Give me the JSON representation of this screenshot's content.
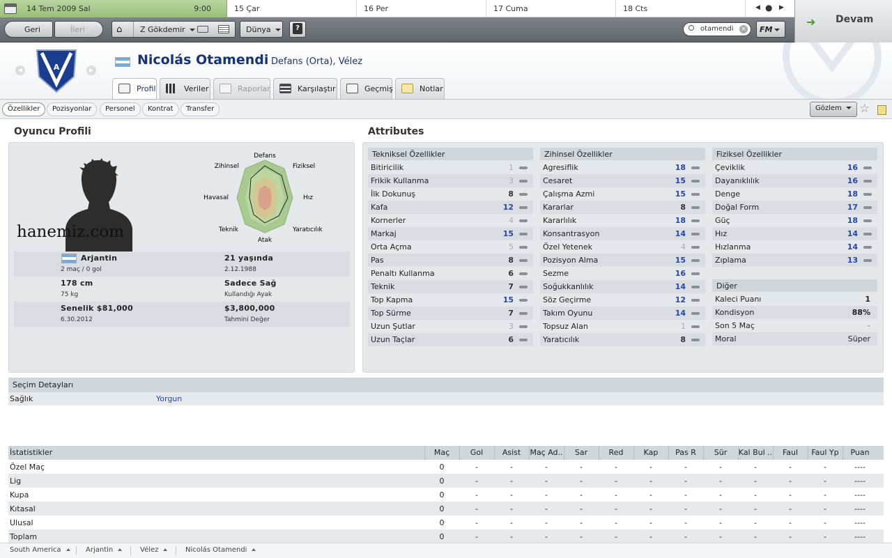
{
  "date_bar": {
    "today": {
      "date": "14 Tem 2009  Sal",
      "time": "9:00"
    },
    "days": [
      "15  Çar",
      "16  Per",
      "17  Cuma",
      "18  Cts"
    ]
  },
  "toolbar": {
    "back": "Geri",
    "forward": "İleri",
    "manager": "Z Gökdemir",
    "world": "Dünya",
    "help": "?",
    "search_value": "otamendi",
    "fm_menu": "FM",
    "continue": "Devam"
  },
  "player": {
    "name": "Nicolás Otamendi",
    "position": "Defans (Orta), Vélez"
  },
  "tabs": [
    "Profil",
    "Veriler",
    "Raporlar",
    "Karşılaştır",
    "Geçmiş",
    "Notlar"
  ],
  "subtabs": [
    "Özellikler",
    "Pozisyonlar",
    "Personel",
    "Kontrat",
    "Transfer"
  ],
  "scout_button": "Gözlem",
  "profile": {
    "title": "Oyuncu Profili",
    "watermark": "hanemiz.com",
    "radar_labels": [
      "Defans",
      "Fiziksel",
      "Hız",
      "Yaratıcılık",
      "Atak",
      "Teknik",
      "Havasal",
      "Zihinsel"
    ],
    "nation": "Arjantin",
    "caps": "2 maç / 0 gol",
    "age": "21 yaşında",
    "dob": "2.12.1988",
    "height": "178 cm",
    "weight": "75 kg",
    "foot": "Sadece Sağ",
    "foot_label": "Kullandığı Ayak",
    "wage": "Senelik $81,000",
    "contract_end": "6.30.2012",
    "value": "$3,800,000",
    "value_label": "Tahmini Değer"
  },
  "attributes": {
    "title": "Attributes",
    "technical": {
      "title": "Tekniksel Özellikler",
      "items": [
        {
          "name": "Bitiricilik",
          "value": "1"
        },
        {
          "name": "Frikik Kullanma",
          "value": "3"
        },
        {
          "name": "İlk Dokunuş",
          "value": "8"
        },
        {
          "name": "Kafa",
          "value": "12"
        },
        {
          "name": "Kornerler",
          "value": "4"
        },
        {
          "name": "Markaj",
          "value": "15"
        },
        {
          "name": "Orta Açma",
          "value": "5"
        },
        {
          "name": "Pas",
          "value": "8"
        },
        {
          "name": "Penaltı Kullanma",
          "value": "6"
        },
        {
          "name": "Teknik",
          "value": "7"
        },
        {
          "name": "Top Kapma",
          "value": "15"
        },
        {
          "name": "Top Sürme",
          "value": "7"
        },
        {
          "name": "Uzun Şutlar",
          "value": "3"
        },
        {
          "name": "Uzun Taçlar",
          "value": "6"
        }
      ]
    },
    "mental": {
      "title": "Zihinsel Özellikler",
      "items": [
        {
          "name": "Agresiflik",
          "value": "18"
        },
        {
          "name": "Cesaret",
          "value": "15"
        },
        {
          "name": "Çalışma Azmi",
          "value": "15"
        },
        {
          "name": "Kararlar",
          "value": "8"
        },
        {
          "name": "Kararlılık",
          "value": "18"
        },
        {
          "name": "Konsantrasyon",
          "value": "14"
        },
        {
          "name": "Özel Yetenek",
          "value": "4"
        },
        {
          "name": "Pozisyon Alma",
          "value": "15"
        },
        {
          "name": "Sezme",
          "value": "16"
        },
        {
          "name": "Soğukkanlılık",
          "value": "14"
        },
        {
          "name": "Söz Geçirme",
          "value": "12"
        },
        {
          "name": "Takım Oyunu",
          "value": "14"
        },
        {
          "name": "Topsuz Alan",
          "value": "1"
        },
        {
          "name": "Yaratıcılık",
          "value": "8"
        }
      ]
    },
    "physical": {
      "title": "Fiziksel Özellikler",
      "items": [
        {
          "name": "Çeviklik",
          "value": "16"
        },
        {
          "name": "Dayanıklılık",
          "value": "16"
        },
        {
          "name": "Denge",
          "value": "18"
        },
        {
          "name": "Doğal Form",
          "value": "17"
        },
        {
          "name": "Güç",
          "value": "18"
        },
        {
          "name": "Hız",
          "value": "14"
        },
        {
          "name": "Hızlanma",
          "value": "14"
        },
        {
          "name": "Zıplama",
          "value": "13"
        }
      ]
    },
    "other": {
      "title": "Diğer",
      "items": [
        {
          "name": "Kaleci Puanı",
          "value": "1"
        },
        {
          "name": "Kondisyon",
          "value": "88%"
        },
        {
          "name": "Son 5 Maç",
          "value": "-"
        },
        {
          "name": "Moral",
          "value": "Süper"
        }
      ]
    }
  },
  "selection": {
    "title": "Seçim Detayları",
    "label": "Sağlık",
    "value": "Yorgun"
  },
  "stats": {
    "title": "İstatistikler",
    "columns": [
      "Maç",
      "Gol",
      "Asist",
      "Maç Ad..",
      "Sar",
      "Red",
      "Kap",
      "Pas R",
      "Sür",
      "Kal Bul ..",
      "Faul",
      "Faul Yp",
      "Puan"
    ],
    "rows": [
      {
        "label": "Özel Maç",
        "cells": [
          "0",
          "-",
          "-",
          "-",
          "-",
          "-",
          "-",
          "-",
          "-",
          "-",
          "-",
          "-",
          "----"
        ]
      },
      {
        "label": "Lig",
        "cells": [
          "0",
          "-",
          "-",
          "-",
          "-",
          "-",
          "-",
          "-",
          "-",
          "-",
          "-",
          "-",
          "----"
        ]
      },
      {
        "label": "Kupa",
        "cells": [
          "0",
          "-",
          "-",
          "-",
          "-",
          "-",
          "-",
          "-",
          "-",
          "-",
          "-",
          "-",
          "----"
        ]
      },
      {
        "label": "Kıtasal",
        "cells": [
          "0",
          "-",
          "-",
          "-",
          "-",
          "-",
          "-",
          "-",
          "-",
          "-",
          "-",
          "-",
          "----"
        ]
      },
      {
        "label": "Ulusal",
        "cells": [
          "0",
          "-",
          "-",
          "-",
          "-",
          "-",
          "-",
          "-",
          "-",
          "-",
          "-",
          "-",
          "----"
        ]
      },
      {
        "label": "Toplam",
        "cells": [
          "0",
          "-",
          "-",
          "-",
          "-",
          "-",
          "-",
          "-",
          "-",
          "-",
          "-",
          "-",
          "----"
        ]
      }
    ]
  },
  "breadcrumb": [
    "South America",
    "Arjantin",
    "Vélez",
    "Nicolás Otamendi"
  ]
}
